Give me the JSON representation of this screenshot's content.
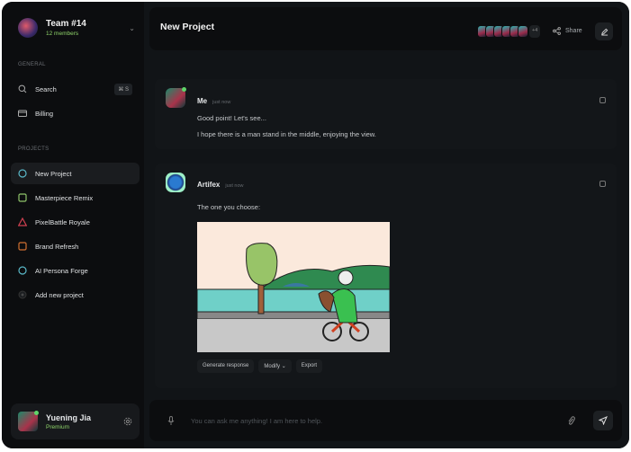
{
  "sidebar": {
    "team": {
      "name": "Team #14",
      "members": "12 members"
    },
    "general_label": "GENERAL",
    "general_items": [
      {
        "label": "Search",
        "shortcut": "⌘ S",
        "icon": "search-icon"
      },
      {
        "label": "Billing",
        "icon": "card-icon"
      }
    ],
    "projects_label": "PROJECTS",
    "projects": [
      {
        "label": "New Project",
        "icon": "circle-icon",
        "color": "#5ab8c8",
        "active": true
      },
      {
        "label": "Masterpiece Remix",
        "icon": "square-icon",
        "color": "#8fc46a"
      },
      {
        "label": "PixelBattle Royale",
        "icon": "triangle-icon",
        "color": "#d04050"
      },
      {
        "label": "Brand Refresh",
        "icon": "square-icon",
        "color": "#d07030"
      },
      {
        "label": "AI Persona Forge",
        "icon": "circle-icon",
        "color": "#5ab8c8"
      }
    ],
    "add_project": "Add new project",
    "user": {
      "name": "Yuening Jia",
      "plan": "Premium"
    }
  },
  "header": {
    "title": "New Project",
    "extra_members": "+4",
    "share": "Share"
  },
  "messages": [
    {
      "author": "Me",
      "time": "just now",
      "lines": [
        "Good point! Let's see...",
        "I hope there is a man stand in the middle, enjoying the view."
      ]
    },
    {
      "author": "Artifex",
      "time": "just now",
      "lines": [
        "The one you choose:"
      ],
      "actions": [
        "Generate response",
        "Modify",
        "Export"
      ]
    }
  ],
  "input": {
    "placeholder": "You can ask me anything! I am here to help."
  }
}
